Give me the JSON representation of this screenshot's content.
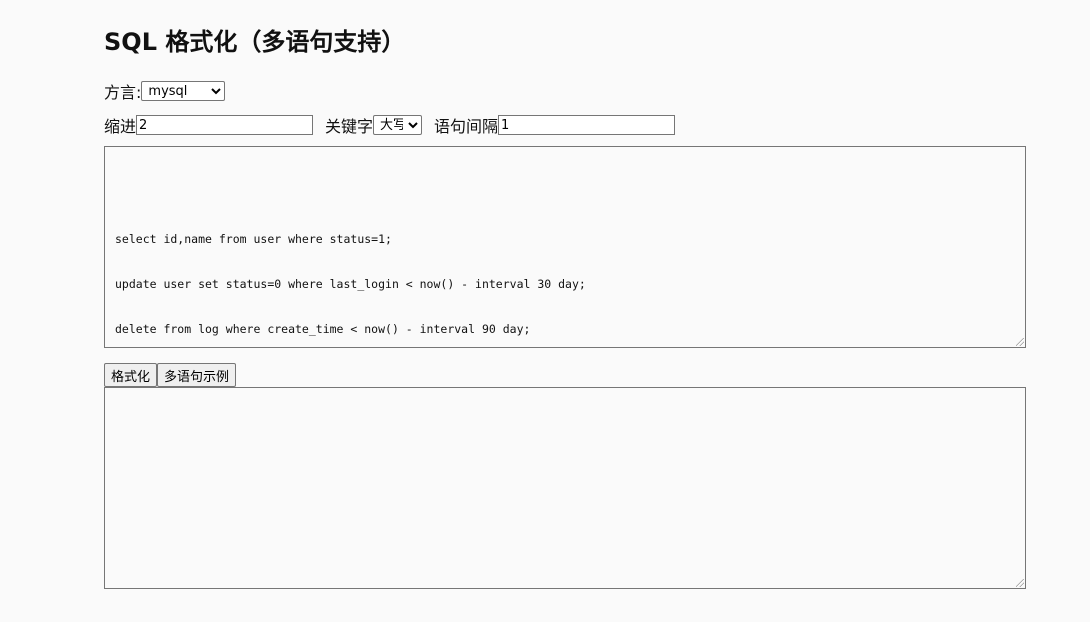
{
  "page": {
    "title": "SQL 格式化（多语句支持）"
  },
  "controls": {
    "dialect_label": "方言:",
    "dialect_value": "mysql",
    "indent_label": "缩进",
    "indent_value": "2",
    "keyword_label": "关键字",
    "keyword_value": "大写",
    "gap_label": "语句间隔",
    "gap_value": "1"
  },
  "input": {
    "lines": [
      "select id,name from user where status=1;",
      "update user set status=0 where last_login < now() - interval 30 day;",
      "delete from log where create_time < now() - interval 90 day;"
    ]
  },
  "actions": {
    "format_label": "格式化",
    "example_label": "多语句示例"
  },
  "output": {
    "text": ""
  }
}
